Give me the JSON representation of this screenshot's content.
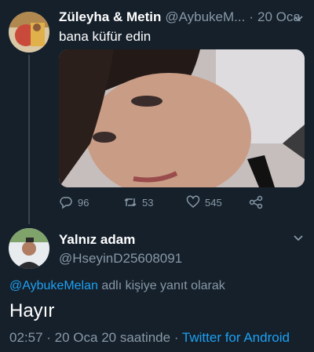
{
  "colors": {
    "background": "#15202b",
    "muted": "#8899a6",
    "accent": "#1da1f2",
    "text": "#ffffff"
  },
  "tweet1": {
    "author_name": "Züleyha & Metin",
    "handle": "@AybukeM...",
    "separator": "·",
    "date": "20 Oca",
    "text": "bana küfür edin",
    "media": "photo",
    "actions": {
      "reply_icon": "reply-icon",
      "reply_count": "96",
      "retweet_icon": "retweet-icon",
      "retweet_count": "53",
      "like_icon": "heart-icon",
      "like_count": "545",
      "share_icon": "share-icon"
    }
  },
  "tweet2": {
    "author_name": "Yalnız adam",
    "handle": "@HseyinD25608091",
    "reply_mention": "@AybukeMelan",
    "reply_suffix": " adlı kişiye yanıt olarak",
    "text": "Hayır",
    "time": "02:57",
    "date_sep": " · ",
    "date_text": "20 Oca 20 saatinde",
    "src_sep": " · ",
    "source": "Twitter for Android"
  }
}
